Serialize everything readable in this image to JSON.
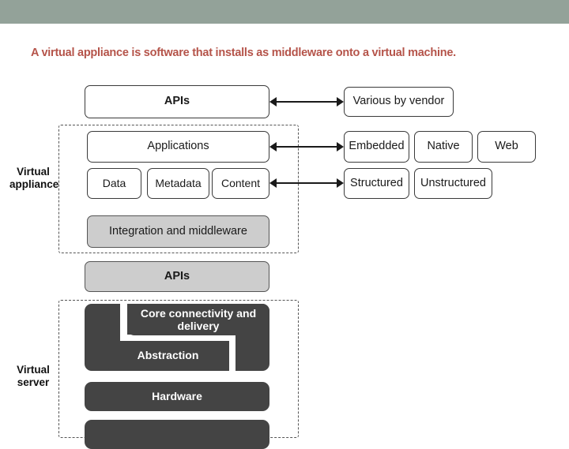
{
  "header": {
    "bar_color": "#93a299"
  },
  "title": {
    "text": "A virtual appliance is software that installs as middleware onto a virtual machine.",
    "color": "#b5544a"
  },
  "colors": {
    "outline": "#3a3a3a",
    "box_white": "#ffffff",
    "box_gray": "#cdcdcd",
    "box_dark": "#444444",
    "dashed": "#555555",
    "arrow": "#1a1a1a"
  },
  "groups": [
    {
      "id": "virtual-appliance",
      "label_line1": "Virtual",
      "label_line2": "appliance"
    },
    {
      "id": "virtual-server",
      "label_line1": "Virtual",
      "label_line2": "server"
    }
  ],
  "left_stack": [
    {
      "id": "apis-top",
      "label": "APIs",
      "fill": "white"
    },
    {
      "id": "applications",
      "label": "Applications",
      "fill": "white"
    },
    {
      "id": "data",
      "label": "Data",
      "fill": "white"
    },
    {
      "id": "metadata",
      "label": "Metadata",
      "fill": "white"
    },
    {
      "id": "content",
      "label": "Content",
      "fill": "white"
    },
    {
      "id": "integration-middleware",
      "label": "Integration and middleware",
      "fill": "gray"
    },
    {
      "id": "apis-bottom",
      "label": "APIs",
      "fill": "gray"
    }
  ],
  "right_stack": [
    {
      "id": "various-by-vendor",
      "label": "Various by vendor"
    },
    {
      "id": "embedded",
      "label": "Embedded"
    },
    {
      "id": "native",
      "label": "Native"
    },
    {
      "id": "web",
      "label": "Web"
    },
    {
      "id": "structured",
      "label": "Structured"
    },
    {
      "id": "unstructured",
      "label": "Unstructured"
    }
  ],
  "server_stack": [
    {
      "id": "core-connectivity",
      "label": "Core connectivity and delivery"
    },
    {
      "id": "abstraction",
      "label": "Abstraction"
    },
    {
      "id": "hardware",
      "label": "Hardware"
    }
  ],
  "arrows": [
    {
      "id": "arrow-apis-vendor",
      "style": "double"
    },
    {
      "id": "arrow-applications-embedded",
      "style": "double"
    },
    {
      "id": "arrow-content-structured",
      "style": "double"
    }
  ]
}
